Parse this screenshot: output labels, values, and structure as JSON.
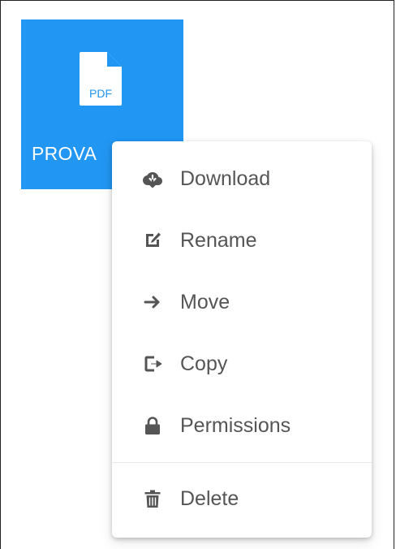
{
  "file": {
    "name": "PROVA",
    "type_label": "PDF",
    "tile_color": "#2196f3",
    "icon": "pdf-file-icon"
  },
  "menu": {
    "items": [
      {
        "label": "Download",
        "icon": "cloud-download-icon"
      },
      {
        "label": "Rename",
        "icon": "edit-icon"
      },
      {
        "label": "Move",
        "icon": "arrow-right-icon"
      },
      {
        "label": "Copy",
        "icon": "copy-icon"
      },
      {
        "label": "Permissions",
        "icon": "lock-icon"
      },
      {
        "label": "Delete",
        "icon": "trash-icon"
      }
    ],
    "text_color": "#555555",
    "icon_color": "#555555"
  }
}
